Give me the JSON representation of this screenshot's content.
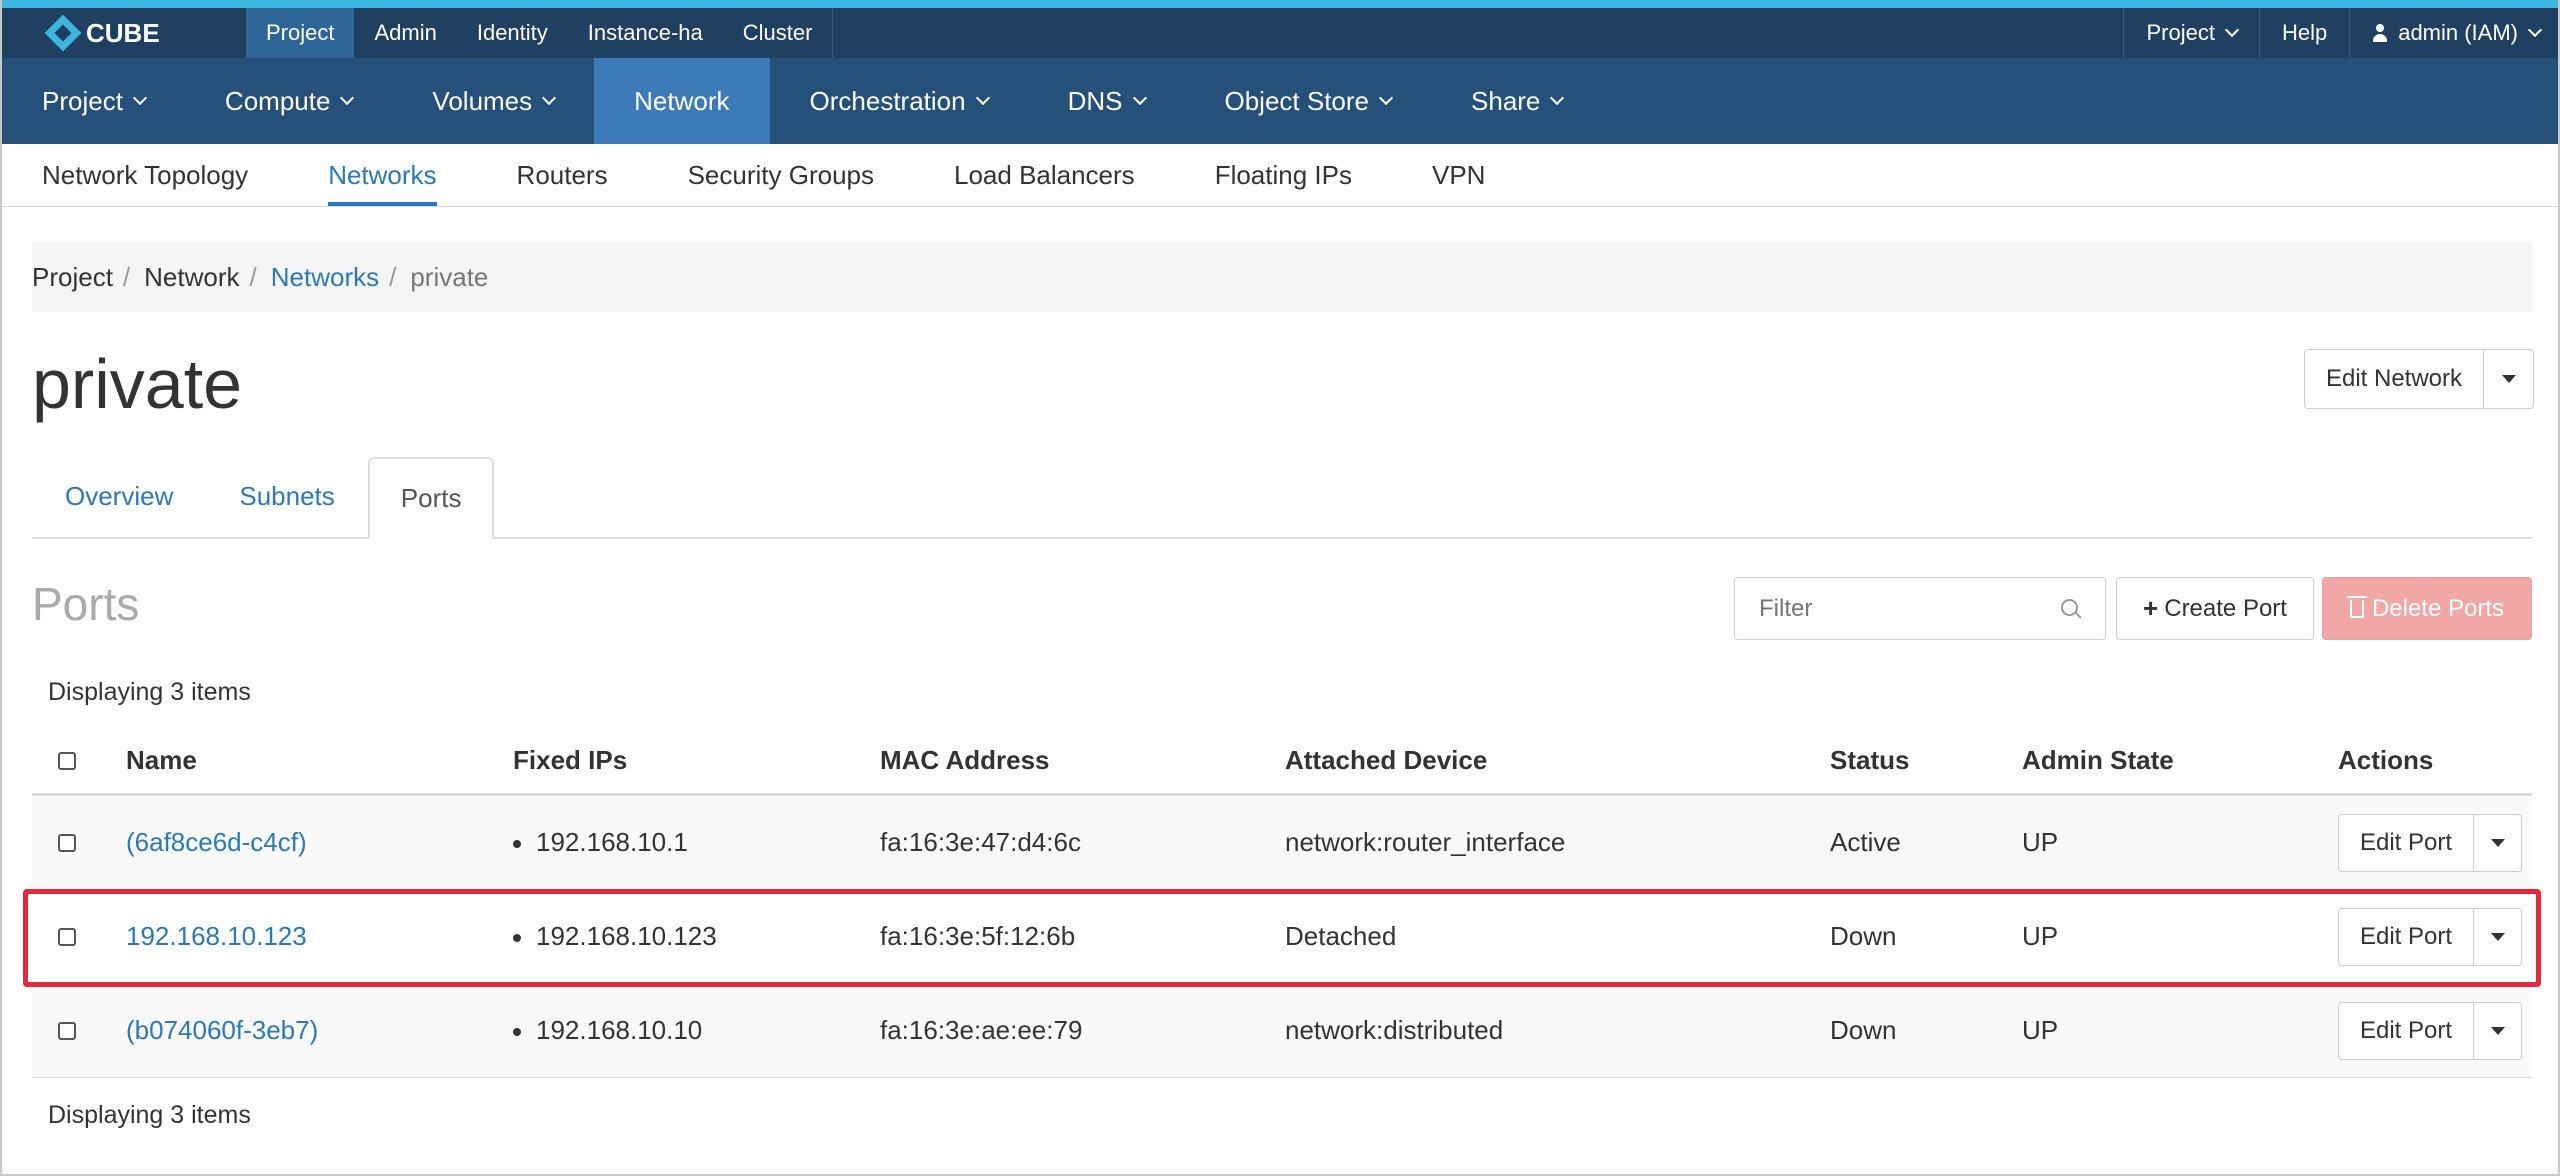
{
  "topbar": {
    "logo": "CUBE",
    "links": [
      "Project",
      "Admin",
      "Identity",
      "Instance-ha",
      "Cluster"
    ],
    "active_link": "Project",
    "project_menu": "Project",
    "help": "Help",
    "user": "admin (IAM)"
  },
  "mainnav": {
    "items": [
      "Project",
      "Compute",
      "Volumes",
      "Network",
      "Orchestration",
      "DNS",
      "Object Store",
      "Share"
    ],
    "active": "Network"
  },
  "subnav": {
    "items": [
      "Network Topology",
      "Networks",
      "Routers",
      "Security Groups",
      "Load Balancers",
      "Floating IPs",
      "VPN"
    ],
    "active": "Networks"
  },
  "breadcrumb": [
    "Project",
    "Network",
    "Networks",
    "private"
  ],
  "page": {
    "title": "private",
    "edit_network": "Edit Network"
  },
  "tabs": {
    "items": [
      "Overview",
      "Subnets",
      "Ports"
    ],
    "active": "Ports"
  },
  "ports": {
    "heading": "Ports",
    "filter_placeholder": "Filter",
    "create_port": "Create Port",
    "delete_ports": "Delete Ports",
    "displaying": "Displaying 3 items",
    "columns": [
      "Name",
      "Fixed IPs",
      "MAC Address",
      "Attached Device",
      "Status",
      "Admin State",
      "Actions"
    ],
    "rows": [
      {
        "name": "(6af8ce6d-c4cf)",
        "fixed_ip": "192.168.10.1",
        "mac": "fa:16:3e:47:d4:6c",
        "device": "network:router_interface",
        "status": "Active",
        "admin_state": "UP",
        "action": "Edit Port"
      },
      {
        "name": "192.168.10.123",
        "fixed_ip": "192.168.10.123",
        "mac": "fa:16:3e:5f:12:6b",
        "device": "Detached",
        "status": "Down",
        "admin_state": "UP",
        "action": "Edit Port"
      },
      {
        "name": "(b074060f-3eb7)",
        "fixed_ip": "192.168.10.10",
        "mac": "fa:16:3e:ae:ee:79",
        "device": "network:distributed",
        "status": "Down",
        "admin_state": "UP",
        "action": "Edit Port"
      }
    ]
  },
  "colors": {
    "topbar": "#1f4060",
    "mainnav": "#24507a",
    "mainnav_active": "#3d7ab8",
    "link": "#2a7ab8",
    "highlight": "#e3293b",
    "danger_button": "#f1a7a5"
  }
}
